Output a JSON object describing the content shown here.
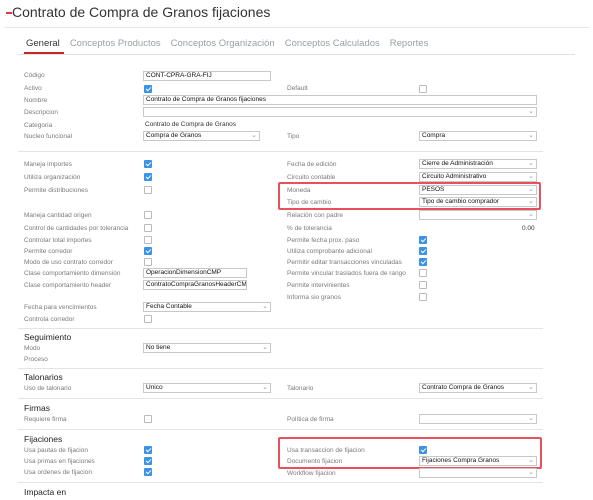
{
  "page": {
    "title": "Contrato de Compra de Granos fijaciones"
  },
  "tabs": [
    "General",
    "Conceptos Productos",
    "Conceptos Organización",
    "Conceptos Calculados",
    "Reportes"
  ],
  "general": {
    "codigo": {
      "label": "Código",
      "value": "CONT-CPRA-GRA-FIJ"
    },
    "activo": {
      "label": "Activo",
      "checked": true
    },
    "default": {
      "label": "Default",
      "checked": false
    },
    "nombre": {
      "label": "Nombre",
      "value": "Contrato de Compra de Granos fijaciones"
    },
    "descripcion": {
      "label": "Descripcion",
      "value": ""
    },
    "categoria": {
      "label": "Categoria",
      "value": "Contrato de Compra de Granos"
    },
    "nucleo": {
      "label": "Nucleo funcional",
      "value": "Compra de Granos"
    },
    "tipo": {
      "label": "Tipo",
      "value": "Compra"
    }
  },
  "options": {
    "maneja_importes": {
      "label": "Maneja importes",
      "checked": true
    },
    "utiliza_organizacion": {
      "label": "Utiliza organización",
      "checked": true
    },
    "permite_distribuciones": {
      "label": "Permite distribuciones",
      "checked": false
    },
    "maneja_cantidad_origen": {
      "label": "Maneja cantidad origen",
      "checked": false
    },
    "control_cantidades": {
      "label": "Control de cantidades por tolerancia",
      "checked": false
    },
    "controlar_total": {
      "label": "Controlar total importes",
      "checked": false
    },
    "permite_corredor": {
      "label": "Permite corredor",
      "checked": true
    },
    "modo_uso_contrato": {
      "label": "Modo de uso contrato corredor",
      "checked": false
    },
    "clase_dimension": {
      "label": "Clase comportamiento dimensión",
      "value": "OperacionDimensionCMP"
    },
    "clase_header": {
      "label": "Clase comportamiento header",
      "value": "ContratoCompraGranosHeaderCMI"
    },
    "fecha_edicion": {
      "label": "Fecha de edición",
      "value": "Cierre de Administración"
    },
    "circuito_contable": {
      "label": "Circuito contable",
      "value": "Circuito Administrativo"
    },
    "moneda": {
      "label": "Moneda",
      "value": "PESOS"
    },
    "tipo_cambio": {
      "label": "Tipo de cambio",
      "value": "Tipo de cambio comprador"
    },
    "relacion_padre": {
      "label": "Relación con padre",
      "value": ""
    },
    "tolerancia": {
      "label": "% de tolerancia",
      "value": "0.00"
    },
    "permite_fecha_prox": {
      "label": "Permite fecha prox. paso",
      "checked": true
    },
    "utiliza_comprobante": {
      "label": "Utiliza comprobante adicional",
      "checked": true
    },
    "permitir_editar_vinculadas": {
      "label": "Permitir editar transacciones vinculadas",
      "checked": true
    },
    "permite_vincular_traslados": {
      "label": "Permite vincular traslados fuera de rango",
      "checked": false
    },
    "permite_intervinientes": {
      "label": "Permite intervinientes",
      "checked": false
    },
    "informa_sio": {
      "label": "Informa sio granos",
      "checked": false
    },
    "fecha_vencimientos": {
      "label": "Fecha para vencimientos",
      "value": "Fecha Contable"
    },
    "controla_corredor": {
      "label": "Controla corredor",
      "checked": false
    }
  },
  "seguimiento": {
    "title": "Seguimiento",
    "modo": {
      "label": "Modo",
      "value": "No tiene"
    },
    "proceso": {
      "label": "Proceso"
    }
  },
  "talonarios": {
    "title": "Talonarios",
    "uso": {
      "label": "Uso de talonario",
      "value": "Unico"
    },
    "talonario": {
      "label": "Talonario",
      "value": "Contrato Compra de Granos"
    }
  },
  "firmas": {
    "title": "Firmas",
    "requiere": {
      "label": "Requiere firma",
      "checked": false
    },
    "politica": {
      "label": "Política de firma",
      "value": ""
    }
  },
  "fijaciones": {
    "title": "Fijaciones",
    "usa_pautas": {
      "label": "Usa pautas de fijacion",
      "checked": true
    },
    "usa_primas": {
      "label": "Usa primas en fijaciones",
      "checked": true
    },
    "usa_ordenes": {
      "label": "Usa ordenes de fijacion",
      "checked": true
    },
    "usa_transaccion": {
      "label": "Usa transaccion de fijacion",
      "checked": true
    },
    "documento": {
      "label": "Documento fijacion",
      "value": "Fijaciones Compra Granos"
    },
    "workflow": {
      "label": "Workflow fijacion",
      "value": ""
    }
  },
  "impacta": {
    "title": "Impacta en"
  },
  "colors": {
    "accent": "#c62828",
    "checkbox": "#3a93e6",
    "highlight": "#e8505b"
  }
}
